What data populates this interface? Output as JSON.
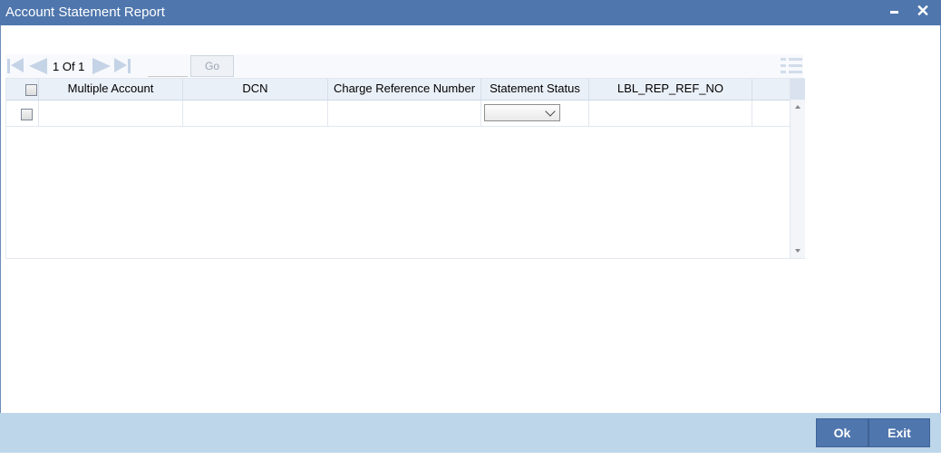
{
  "window": {
    "title": "Account Statement Report",
    "close_glyph": "✕"
  },
  "pagination": {
    "page_info": "1 Of 1",
    "page_input_value": "",
    "go_label": "Go"
  },
  "table": {
    "columns": [
      "Multiple Account",
      "DCN",
      "Charge Reference Number",
      "Statement Status",
      "LBL_REP_REF_NO"
    ],
    "rows": [
      {
        "multiple_account": "",
        "dcn": "",
        "charge_reference_number": "",
        "statement_status": "",
        "lbl_rep_ref_no": ""
      }
    ]
  },
  "footer": {
    "ok_label": "Ok",
    "exit_label": "Exit"
  },
  "colors": {
    "titlebar": "#4f76ad",
    "footer": "#bdd6ea",
    "button": "#4f76ad"
  }
}
